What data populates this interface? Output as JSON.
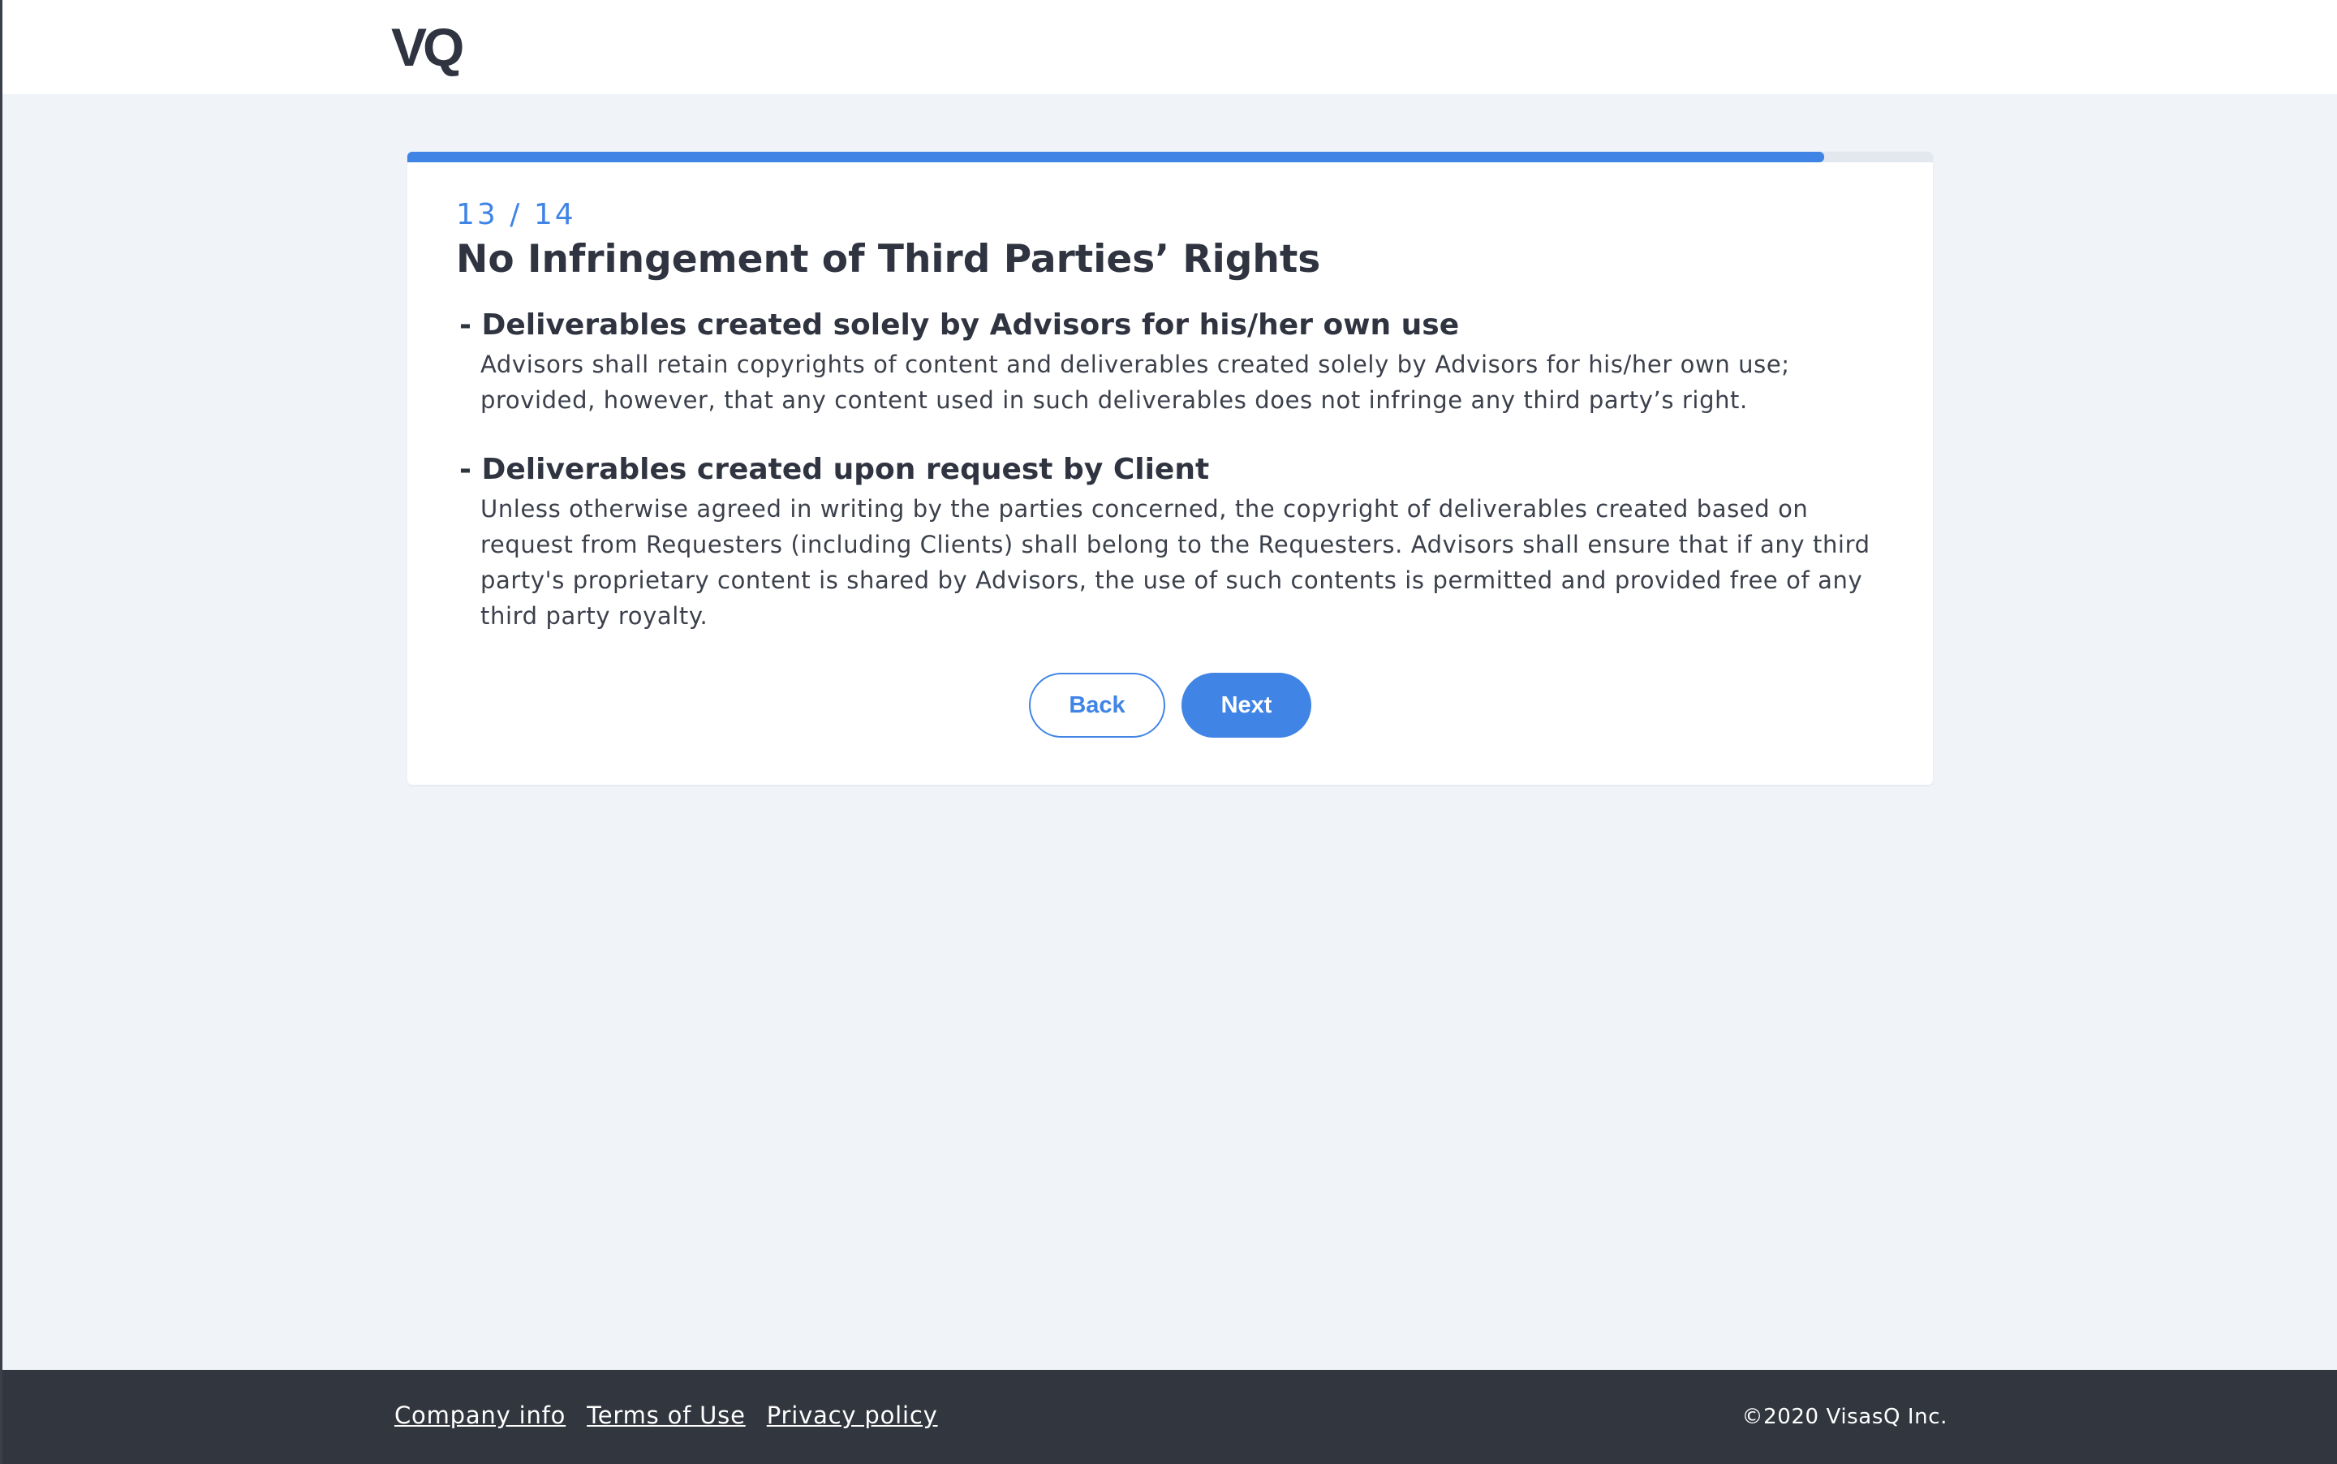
{
  "header": {
    "logo_text": "VQ"
  },
  "progress": {
    "current": 13,
    "total": 14,
    "fraction": 0.9286,
    "label": "13 / 14",
    "color": "#4084e6"
  },
  "page": {
    "title": "No Infringement of Third Parties’ Rights",
    "sections": [
      {
        "heading": "- Deliverables created solely by Advisors for his/her own use",
        "body": "Advisors shall retain copyrights of content and deliverables created solely by Advisors for his/her own use; provided, however, that any content used in such deliverables does not infringe any third party’s right."
      },
      {
        "heading": "- Deliverables created upon request by Client",
        "body": "Unless otherwise agreed in writing by the parties concerned, the copyright of deliverables created based on request from Requesters (including Clients) shall belong to the Requesters. Advisors shall ensure that if any third party's proprietary content is shared by Advisors, the use of such contents is permitted and provided free of any third party royalty."
      }
    ]
  },
  "actions": {
    "back_label": "Back",
    "next_label": "Next"
  },
  "footer": {
    "links": [
      "Company info",
      "Terms of Use",
      "Privacy policy"
    ],
    "copyright": "©2020 VisasQ Inc."
  },
  "colors": {
    "accent": "#4084e6",
    "background": "#f0f4f8",
    "footer_bg": "#32363f",
    "text": "#2f3440"
  }
}
